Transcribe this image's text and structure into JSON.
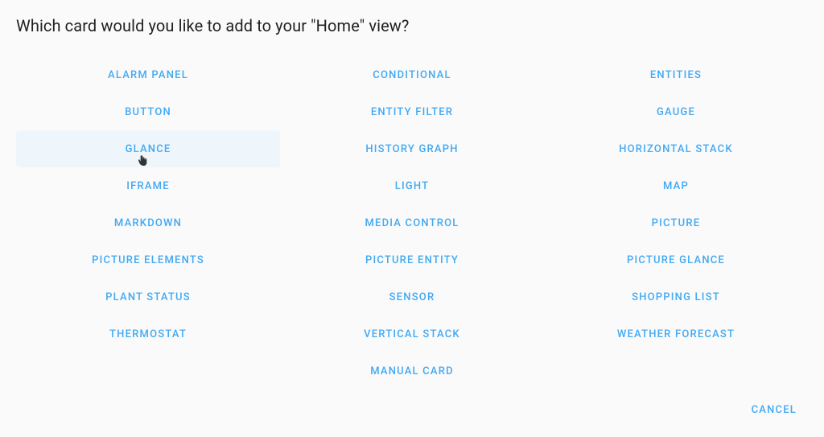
{
  "dialog": {
    "title": "Which card would you like to add to your \"Home\" view?",
    "cancel_label": "CANCEL",
    "hovered_index": 6,
    "cards": [
      "ALARM PANEL",
      "CONDITIONAL",
      "ENTITIES",
      "BUTTON",
      "ENTITY FILTER",
      "GAUGE",
      "GLANCE",
      "HISTORY GRAPH",
      "HORIZONTAL STACK",
      "IFRAME",
      "LIGHT",
      "MAP",
      "MARKDOWN",
      "MEDIA CONTROL",
      "PICTURE",
      "PICTURE ELEMENTS",
      "PICTURE ENTITY",
      "PICTURE GLANCE",
      "PLANT STATUS",
      "SENSOR",
      "SHOPPING LIST",
      "THERMOSTAT",
      "VERTICAL STACK",
      "WEATHER FORECAST",
      "MANUAL CARD"
    ]
  }
}
